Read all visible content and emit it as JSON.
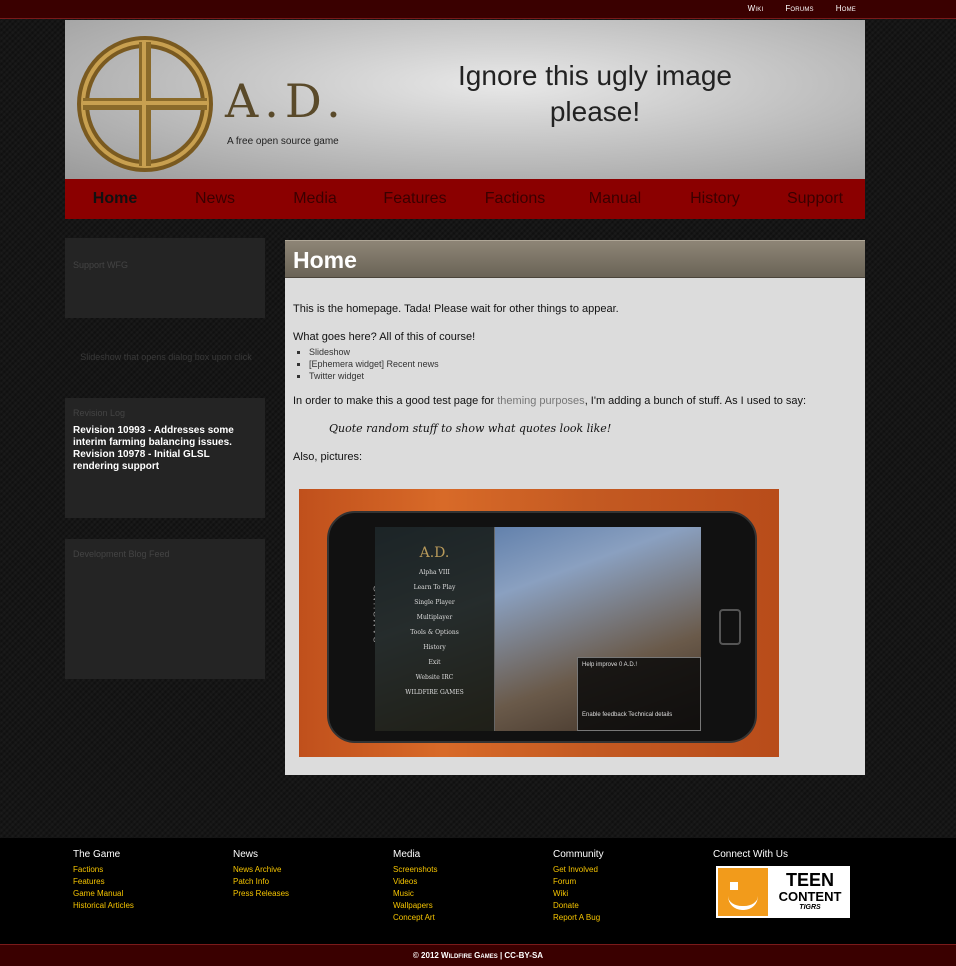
{
  "topbar": {
    "links": [
      "Wiki",
      "Forums",
      "Home"
    ]
  },
  "header": {
    "logo_text": "A.D.",
    "tagline": "A free open source game",
    "note_line1": "Ignore this ugly image",
    "note_line2": "please!"
  },
  "nav": [
    "Home",
    "News",
    "Media",
    "Features",
    "Factions",
    "Manual",
    "History",
    "Support"
  ],
  "sidebar": {
    "support_title": "Support WFG",
    "slideshow_note": "Slideshow that opens dialog box upon click",
    "revision_title": "Revision Log",
    "revision_entries": "Revision 10993 - Addresses some interim farming balancing issues. Revision 10978 - Initial GLSL rendering support",
    "dev_title": "Development Blog Feed"
  },
  "content": {
    "title": "Home",
    "intro": "This is the homepage. Tada! Please wait for other things to appear.",
    "what_goes": "What goes here? All of this of course!",
    "list": [
      "Slideshow",
      "[Ephemera widget] Recent news",
      "Twitter widget"
    ],
    "para_before_link": "In order to make this a good test page for ",
    "para_link": "theming purposes",
    "para_after_link": ", I'm adding a bunch of stuff.  As I used to say:",
    "quote": "Quote random stuff to show what quotes look like!",
    "pictures_label": "Also, pictures:",
    "photo": {
      "phone_brand": "SAMSUNG",
      "screen_logo": "A.D.",
      "menu_items": [
        "Alpha VIII",
        "Learn To Play",
        "Single Player",
        "Multiplayer",
        "Tools & Options",
        "History",
        "Exit",
        "Website   IRC",
        "WILDFIRE GAMES"
      ],
      "help_title": "Help improve 0 A.D.!",
      "help_buttons": "Enable feedback    Technical details"
    }
  },
  "footer": {
    "columns": [
      {
        "heading": "The Game",
        "links": [
          "Factions",
          "Features",
          "Game Manual",
          "Historical Articles"
        ]
      },
      {
        "heading": "News",
        "links": [
          "News Archive",
          "Patch Info",
          "Press Releases"
        ]
      },
      {
        "heading": "Media",
        "links": [
          "Screenshots",
          "Videos",
          "Music",
          "Wallpapers",
          "Concept Art"
        ]
      },
      {
        "heading": "Community",
        "links": [
          "Get Involved",
          "Forum",
          "Wiki",
          "Donate",
          "Report A Bug"
        ]
      }
    ],
    "connect_heading": "Connect With Us",
    "badge_line1": "TEEN",
    "badge_line2": "CONTENT",
    "badge_line3": "TIGRS",
    "copyright": "© 2012 Wildfire Games | CC-BY-SA"
  }
}
